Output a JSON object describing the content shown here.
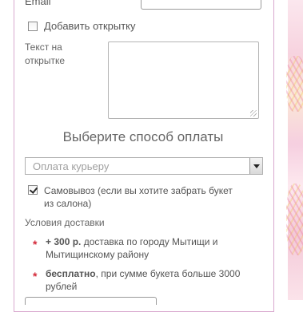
{
  "form": {
    "email_label": "Email",
    "email_value": "",
    "add_postcard_label": "Добавить открытку",
    "add_postcard_checked": false,
    "postcard_text_label": "Текст на открытке",
    "postcard_text_value": ""
  },
  "payment": {
    "section_title": "Выберите способ оплаты",
    "method_selected": "Оплата курьеру",
    "pickup_label": "Самовывоз (если вы хотите забрать букет из салона)",
    "pickup_checked": true
  },
  "delivery": {
    "conditions_title": "Условия доставки",
    "items": [
      {
        "bold": "+ 300 р.",
        "text": " доставка по городу Мытищи и Мытищинскому району"
      },
      {
        "bold": "бесплатно",
        "text": ", при сумме букета больше 3000 рублей"
      }
    ],
    "bullet_symbol": "*"
  },
  "colors": {
    "panel_border": "#d9a9cf",
    "bullet": "#d42a3a",
    "text": "#555555"
  }
}
